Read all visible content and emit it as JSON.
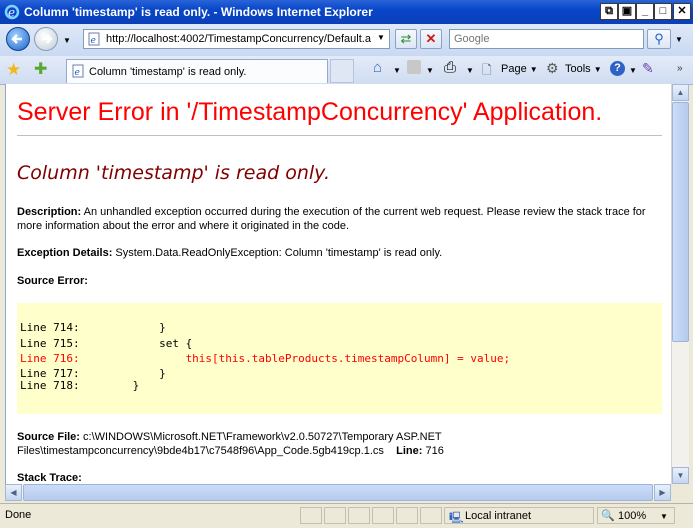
{
  "window": {
    "title": "Column 'timestamp' is read only. - Windows Internet Explorer",
    "controls": [
      "minimize-to-tray",
      "restore-small",
      "minimize",
      "maximize",
      "close"
    ]
  },
  "nav": {
    "url": "http://localhost:4002/TimestampConcurrency/Default.a",
    "search_placeholder": "Google"
  },
  "tab": {
    "label": "Column 'timestamp' is read only."
  },
  "toolbar": {
    "page_label": "Page",
    "tools_label": "Tools"
  },
  "page": {
    "heading": "Server Error in '/TimestampConcurrency' Application.",
    "error_title": "Column 'timestamp' is read only.",
    "description_label": "Description:",
    "description_text": " An unhandled exception occurred during the execution of the current web request. Please review the stack trace for more information about the error and where it originated in the code.",
    "exception_label": "Exception Details:",
    "exception_text": " System.Data.ReadOnlyException: Column 'timestamp' is read only.",
    "source_error_label": "Source Error:",
    "code_lines": [
      "Line 714:            }",
      "Line 715:            set {",
      "Line 716:                this[this.tableProducts.timestampColumn] = value;",
      "Line 717:            }",
      "Line 718:        }"
    ],
    "source_file_label": "Source File:",
    "source_file_path": " c:\\WINDOWS\\Microsoft.NET\\Framework\\v2.0.50727\\Temporary ASP.NET Files\\timestampconcurrency\\9bde4b17\\c7548f96\\App_Code.5gb419cp.1.cs",
    "line_label": "Line:",
    "line_value": " 716",
    "stack_trace_label": "Stack Trace:"
  },
  "status": {
    "text": "Done",
    "zone": "Local intranet",
    "zoom": "100%"
  }
}
